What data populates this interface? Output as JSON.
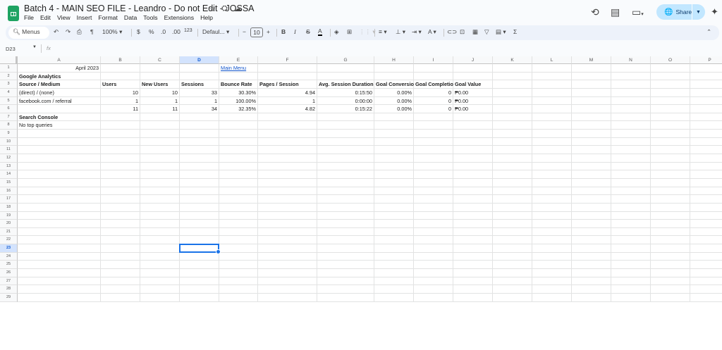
{
  "app": {
    "title": "Batch 4 - MAIN SEO FILE - Leandro - Do not Edit - JOSSA",
    "menu": [
      "File",
      "Edit",
      "View",
      "Insert",
      "Format",
      "Data",
      "Tools",
      "Extensions",
      "Help"
    ],
    "share_label": "Share",
    "accent": "#1a73e8"
  },
  "toolbar": {
    "search_label": "Menus",
    "zoom": "100%",
    "currency": "$",
    "percent": "%",
    "dec_decrease": ".0",
    "dec_increase": ".00",
    "number_format": "123",
    "font": "Defaul...",
    "font_size": "10"
  },
  "formula_bar": {
    "cell_ref": "D23",
    "fx": "fx",
    "value": ""
  },
  "sheet": {
    "columns": [
      "A",
      "B",
      "C",
      "D",
      "E",
      "F",
      "G",
      "H",
      "I",
      "J",
      "K",
      "L",
      "M",
      "N",
      "O",
      "P"
    ],
    "row_count": 29,
    "selected_cell": "D23",
    "cells": [
      {
        "ref": "A1",
        "value": "April 2023",
        "style": "right"
      },
      {
        "ref": "E1",
        "value": "Main Menu",
        "style": "link"
      },
      {
        "ref": "A2",
        "value": "Google Analytics",
        "style": "bold"
      },
      {
        "ref": "A3",
        "value": "Source / Medium",
        "style": "bold"
      },
      {
        "ref": "B3",
        "value": "Users",
        "style": "bold"
      },
      {
        "ref": "C3",
        "value": "New Users",
        "style": "bold"
      },
      {
        "ref": "D3",
        "value": "Sessions",
        "style": "bold"
      },
      {
        "ref": "E3",
        "value": "Bounce Rate",
        "style": "bold"
      },
      {
        "ref": "F3",
        "value": "Pages / Session",
        "style": "bold"
      },
      {
        "ref": "G3",
        "value": "Avg. Session Duration",
        "style": "bold"
      },
      {
        "ref": "H3",
        "value": "Goal Conversio",
        "style": "bold"
      },
      {
        "ref": "I3",
        "value": "Goal Completio",
        "style": "bold"
      },
      {
        "ref": "J3",
        "value": "Goal Value",
        "style": "bold"
      },
      {
        "ref": "A4",
        "value": "(direct) / (none)"
      },
      {
        "ref": "B4",
        "value": "10",
        "style": "right"
      },
      {
        "ref": "C4",
        "value": "10",
        "style": "right"
      },
      {
        "ref": "D4",
        "value": "33",
        "style": "right"
      },
      {
        "ref": "E4",
        "value": "30.30%",
        "style": "right"
      },
      {
        "ref": "F4",
        "value": "4.94",
        "style": "right"
      },
      {
        "ref": "G4",
        "value": "0:15:50",
        "style": "right"
      },
      {
        "ref": "H4",
        "value": "0.00%",
        "style": "right"
      },
      {
        "ref": "I4",
        "value": "0",
        "style": "right"
      },
      {
        "ref": "J4",
        "value": "₱0.00"
      },
      {
        "ref": "A5",
        "value": "facebook.com / referral"
      },
      {
        "ref": "B5",
        "value": "1",
        "style": "right"
      },
      {
        "ref": "C5",
        "value": "1",
        "style": "right"
      },
      {
        "ref": "D5",
        "value": "1",
        "style": "right"
      },
      {
        "ref": "E5",
        "value": "100.00%",
        "style": "right"
      },
      {
        "ref": "F5",
        "value": "1",
        "style": "right"
      },
      {
        "ref": "G5",
        "value": "0:00:00",
        "style": "right"
      },
      {
        "ref": "H5",
        "value": "0.00%",
        "style": "right"
      },
      {
        "ref": "I5",
        "value": "0",
        "style": "right"
      },
      {
        "ref": "J5",
        "value": "₱0.00"
      },
      {
        "ref": "B6",
        "value": "11",
        "style": "right"
      },
      {
        "ref": "C6",
        "value": "11",
        "style": "right"
      },
      {
        "ref": "D6",
        "value": "34",
        "style": "right"
      },
      {
        "ref": "E6",
        "value": "32.35%",
        "style": "right"
      },
      {
        "ref": "F6",
        "value": "4.82",
        "style": "right"
      },
      {
        "ref": "G6",
        "value": "0:15:22",
        "style": "right"
      },
      {
        "ref": "H6",
        "value": "0.00%",
        "style": "right"
      },
      {
        "ref": "I6",
        "value": "0",
        "style": "right"
      },
      {
        "ref": "J6",
        "value": "₱0.00"
      },
      {
        "ref": "A7",
        "value": "Search Console",
        "style": "bold"
      },
      {
        "ref": "A8",
        "value": "No top queries"
      }
    ]
  }
}
